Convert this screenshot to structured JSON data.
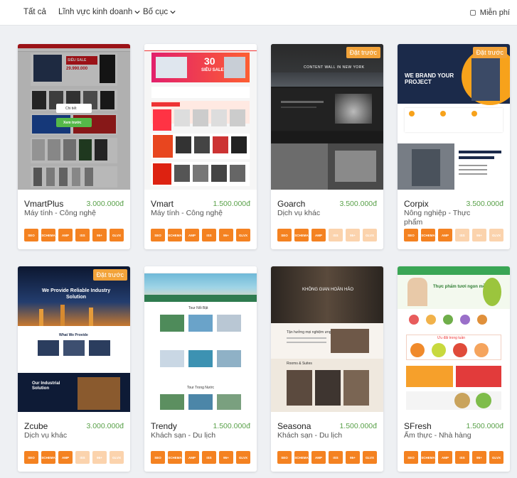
{
  "filters": {
    "all": "Tất cả",
    "industry": "Lĩnh vực kinh doanh",
    "layout": "Bố cục",
    "free": "Miễn phí"
  },
  "badge_label": "Đặt trước",
  "feature_labels": [
    "SEO",
    "SCHEMA",
    "AMP",
    "ISS",
    "95+",
    "GLVX"
  ],
  "colors": {
    "accent": "#f48221",
    "accent_off": "#fbd3ad",
    "price": "#5aa14a",
    "badge": "#f2a33a"
  },
  "thumb_texts": {
    "vmartplus_banner": "SIÊU SALE",
    "vmartplus_price": "29.990.000",
    "vmartplus_detail": "Chi tiết",
    "vmartplus_view": "Xem trước",
    "vmart_sale_num": "30",
    "vmart_sale": "SIÊU SALE",
    "goarch_title": "CONTENT WALL IN NEW YORK",
    "corpix_hero": "WE BRAND YOUR PROJECT",
    "zcube_hero": "We Provide Reliable Industry Solution",
    "zcube_provide": "What We Provide",
    "zcube_solution": "Our Industrial Solution",
    "trendy_section": "Tour Nổi Bật",
    "trendy_section2": "Tour Trong Nước",
    "seasona_hero": "KHÔNG GIAN HOÀN HẢO",
    "seasona_section": "Tận hưởng mọi nghiệm ưng ứng",
    "seasona_rooms": "Rooms & Suites",
    "sfresh_hero": "Thực phẩm tươi ngon mỗi ngày",
    "sfresh_sale": "Ưu đãi trong tuần"
  },
  "templates": [
    {
      "name": "VmartPlus",
      "price": "3.000.000đ",
      "category": "Máy tính - Công nghệ",
      "preorder": false,
      "features": [
        1,
        1,
        1,
        1,
        1,
        1
      ]
    },
    {
      "name": "Vmart",
      "price": "1.500.000đ",
      "category": "Máy tính - Công nghệ",
      "preorder": false,
      "features": [
        1,
        1,
        1,
        1,
        1,
        1
      ]
    },
    {
      "name": "Goarch",
      "price": "3.500.000đ",
      "category": "Dịch vụ khác",
      "preorder": true,
      "features": [
        1,
        1,
        1,
        0,
        0,
        0
      ]
    },
    {
      "name": "Corpix",
      "price": "3.500.000đ",
      "category": "Nông nghiệp - Thực phẩm",
      "preorder": true,
      "features": [
        1,
        1,
        1,
        0,
        0,
        0
      ]
    },
    {
      "name": "Zcube",
      "price": "3.000.000đ",
      "category": "Dịch vụ khác",
      "preorder": true,
      "features": [
        1,
        1,
        1,
        0,
        0,
        0
      ]
    },
    {
      "name": "Trendy",
      "price": "1.500.000đ",
      "category": "Khách sạn - Du lịch",
      "preorder": false,
      "features": [
        1,
        1,
        1,
        1,
        1,
        1
      ]
    },
    {
      "name": "Seasona",
      "price": "1.500.000đ",
      "category": "Khách sạn - Du lịch",
      "preorder": false,
      "features": [
        1,
        1,
        1,
        1,
        1,
        1
      ]
    },
    {
      "name": "SFresh",
      "price": "1.500.000đ",
      "category": "Ẩm thực - Nhà hàng",
      "preorder": false,
      "features": [
        1,
        1,
        1,
        1,
        1,
        1
      ]
    }
  ]
}
